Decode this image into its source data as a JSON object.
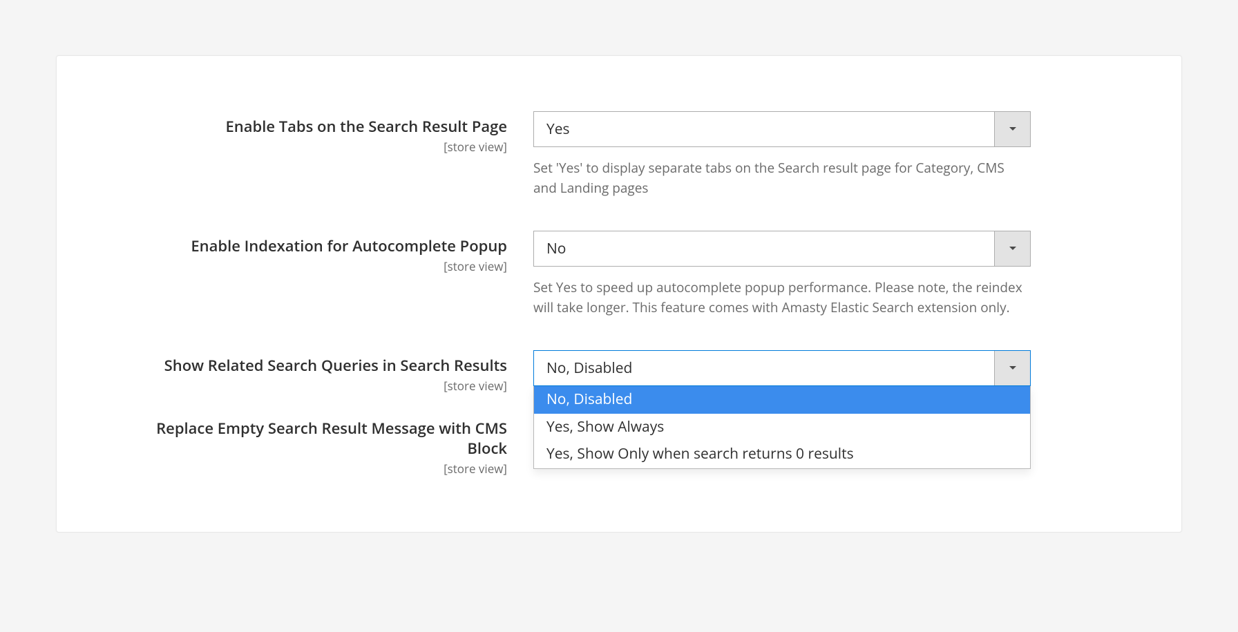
{
  "fields": {
    "enable_tabs": {
      "label": "Enable Tabs on the Search Result Page",
      "scope": "[store view]",
      "value": "Yes",
      "helper": "Set 'Yes' to display separate tabs on the Search result page for Category, CMS and Landing pages"
    },
    "enable_indexation": {
      "label": "Enable Indexation for Autocomplete Popup",
      "scope": "[store view]",
      "value": "No",
      "helper": "Set Yes to speed up autocomplete popup performance. Please note, the reindex will take longer. This feature comes with Amasty Elastic Search extension only."
    },
    "show_related": {
      "label": "Show Related Search Queries in Search Results",
      "scope": "[store view]",
      "value": "No, Disabled",
      "options": [
        "No, Disabled",
        "Yes, Show Always",
        "Yes, Show Only when search returns 0 results"
      ]
    },
    "replace_empty": {
      "label": "Replace Empty Search Result Message with CMS Block",
      "scope": "[store view]"
    }
  }
}
